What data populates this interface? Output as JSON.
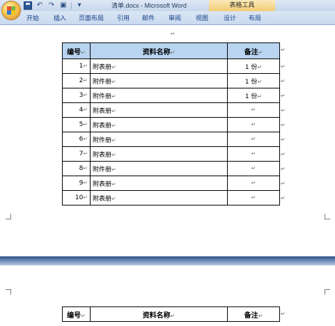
{
  "window": {
    "title": "清单.docx - Microsoft Word",
    "context_tab": "表格工具"
  },
  "ribbon": {
    "tabs": [
      "开始",
      "插入",
      "页面布局",
      "引用",
      "邮件",
      "审阅",
      "视图",
      "设计",
      "布局"
    ]
  },
  "marks": {
    "cell": "↵",
    "para": "↵"
  },
  "table": {
    "headers": [
      "编号",
      "资料名称",
      "备注"
    ],
    "rows": [
      {
        "num": "1",
        "name": "附表册",
        "note": "1 份"
      },
      {
        "num": "2",
        "name": "附件册",
        "note": "1 份"
      },
      {
        "num": "3",
        "name": "附件册",
        "note": "1 份"
      },
      {
        "num": "4",
        "name": "附表册",
        "note": ""
      },
      {
        "num": "5",
        "name": "附表册",
        "note": ""
      },
      {
        "num": "6",
        "name": "附件册",
        "note": ""
      },
      {
        "num": "7",
        "name": "附表册",
        "note": ""
      },
      {
        "num": "8",
        "name": "附件册",
        "note": ""
      },
      {
        "num": "9",
        "name": "附表册",
        "note": ""
      },
      {
        "num": "10",
        "name": "附表册",
        "note": ""
      }
    ]
  },
  "table2": {
    "headers": [
      "编号",
      "资料名称",
      "备注"
    ]
  }
}
